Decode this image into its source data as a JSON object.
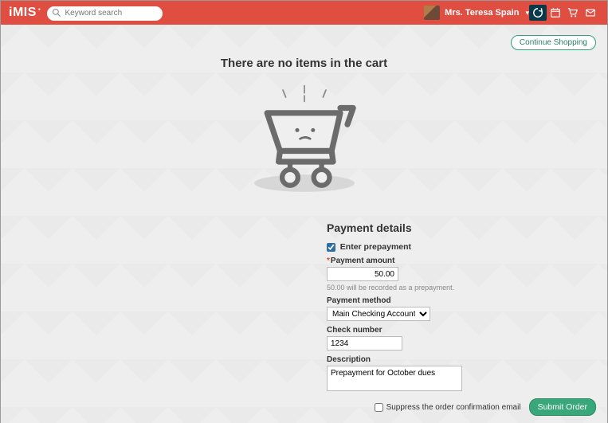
{
  "header": {
    "logo_text": "iMIS",
    "search_placeholder": "Keyword search",
    "user_name": "Mrs. Teresa Spain"
  },
  "cart": {
    "continue_shopping": "Continue Shopping",
    "empty_title": "There are no items in the cart"
  },
  "payment": {
    "title": "Payment details",
    "enter_prepayment_label": "Enter prepayment",
    "enter_prepayment_checked": true,
    "amount_label": "Payment amount",
    "amount_value": "50.00",
    "prepay_note": "50.00 will be recorded as a prepayment.",
    "method_label": "Payment method",
    "method_value": "Main Checking Account",
    "check_label": "Check number",
    "check_value": "1234",
    "description_label": "Description",
    "description_value": "Prepayment for October dues"
  },
  "footer": {
    "suppress_label": "Suppress the order confirmation email",
    "submit_label": "Submit Order"
  }
}
